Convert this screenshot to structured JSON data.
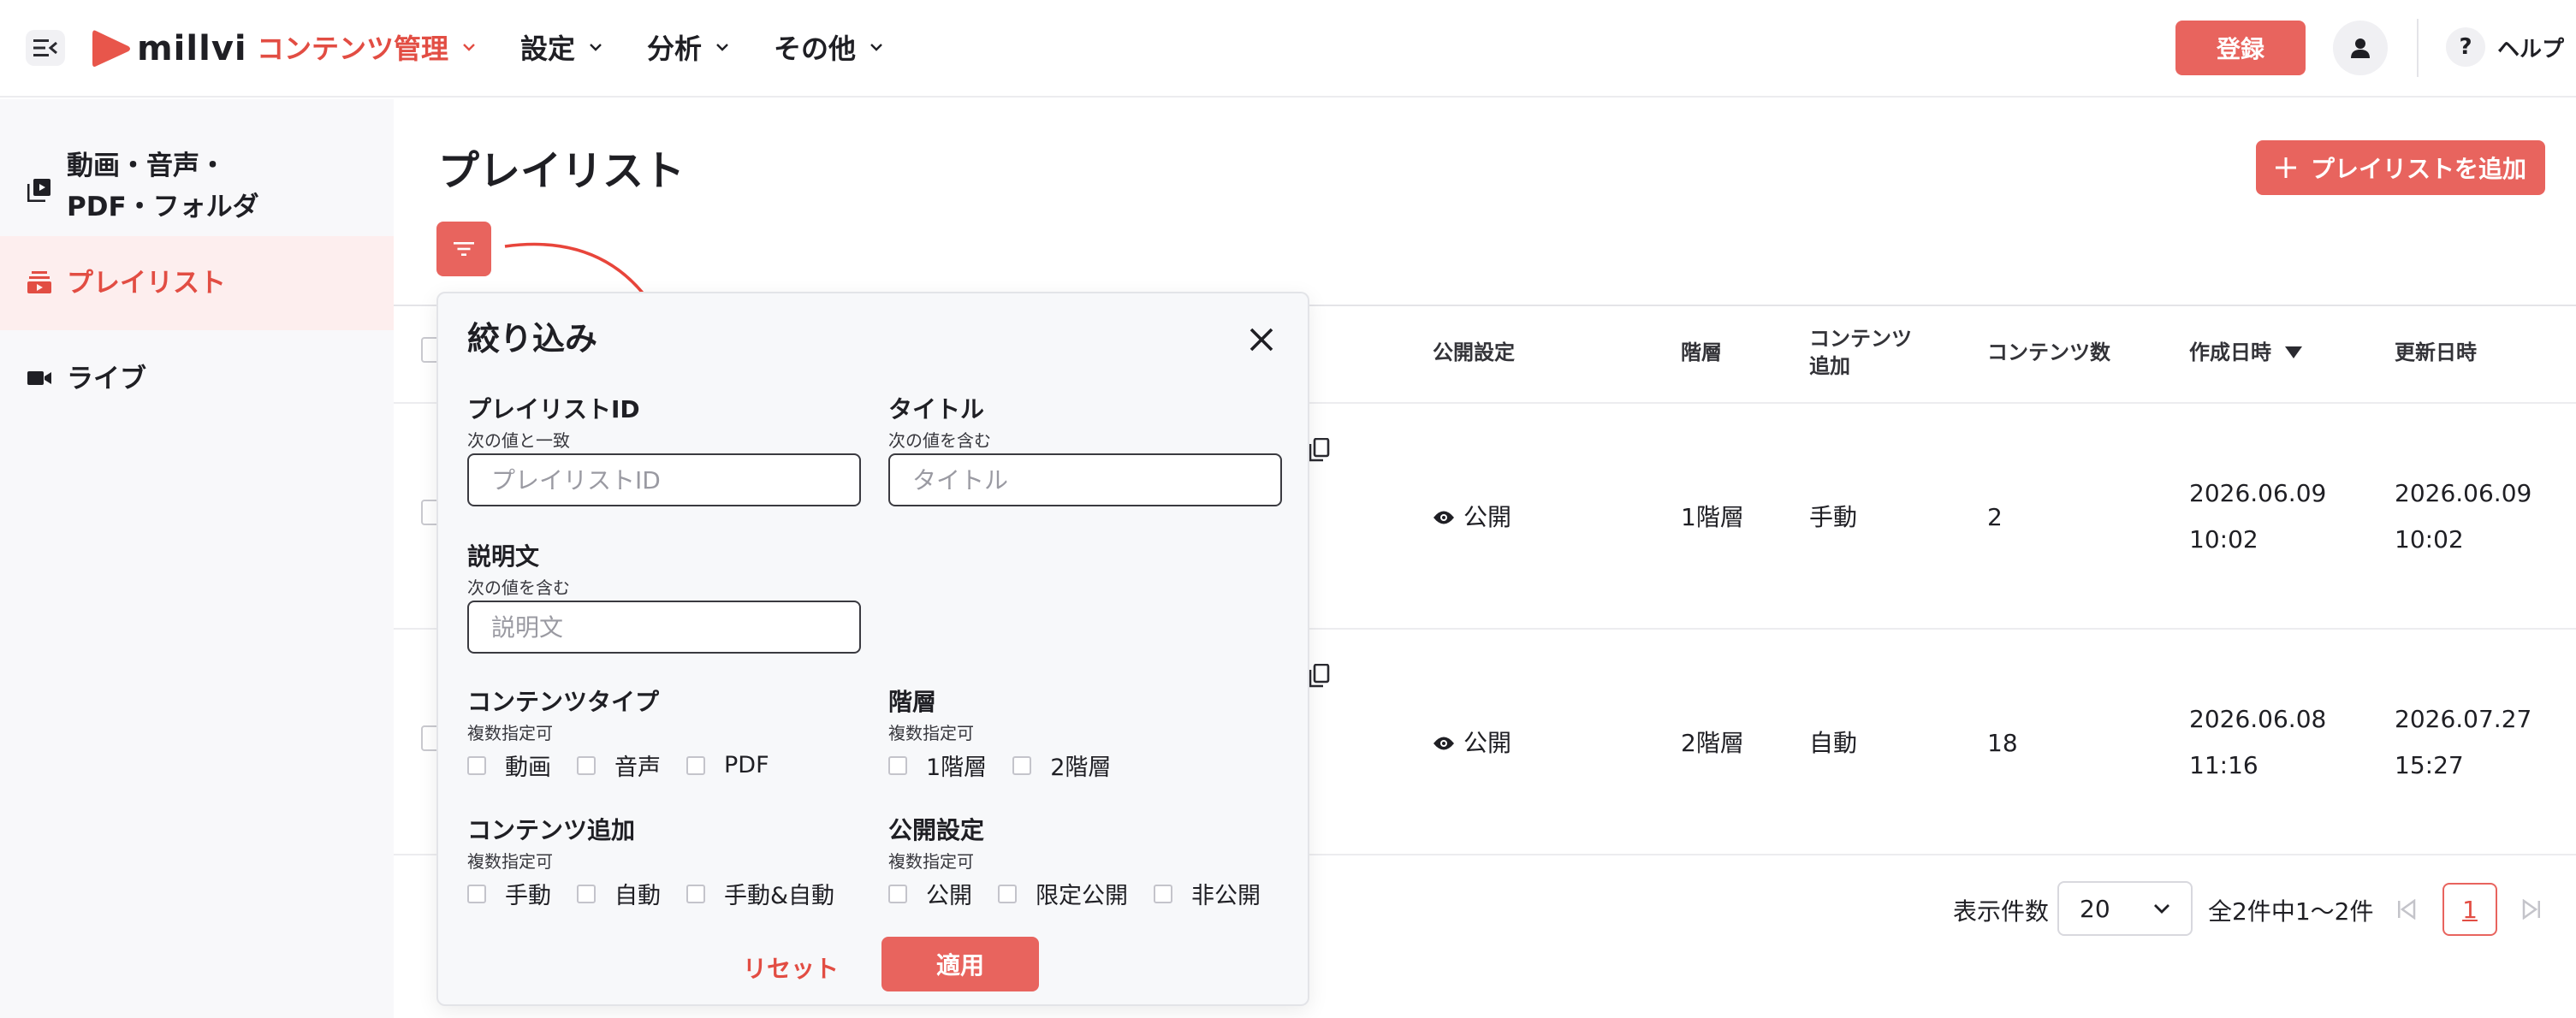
{
  "header": {
    "logo_text": "millvi",
    "nav": [
      {
        "label": "コンテンツ管理",
        "active": true
      },
      {
        "label": "設定",
        "active": false
      },
      {
        "label": "分析",
        "active": false
      },
      {
        "label": "その他",
        "active": false
      }
    ],
    "register_label": "登録",
    "help_symbol": "?",
    "help_label": "ヘルプ"
  },
  "sidebar": {
    "items": [
      {
        "label": "動画・音声・\nPDF・フォルダ",
        "line1": "動画・音声・",
        "line2": "PDF・フォルダ",
        "icon": "media-library-icon"
      },
      {
        "label": "プレイリスト",
        "icon": "playlist-icon",
        "active": true
      },
      {
        "label": "ライブ",
        "icon": "live-camera-icon"
      }
    ]
  },
  "main": {
    "title": "プレイリスト",
    "add_button_label": "プレイリストを追加",
    "add_button_icon": "plus-icon",
    "filter_button_icon": "filter-icon"
  },
  "table": {
    "columns": {
      "publish": "公開設定",
      "hierarchy": "階層",
      "content_add_1": "コンテンツ",
      "content_add_2": "追加",
      "content_count": "コンテンツ数",
      "created": "作成日時",
      "updated": "更新日時"
    },
    "rows": [
      {
        "publish": "公開",
        "hierarchy": "1階層",
        "content_add": "手動",
        "content_count": "2",
        "created_date": "2026.06.09",
        "created_time": "10:02",
        "updated_date": "2026.06.09",
        "updated_time": "10:02"
      },
      {
        "publish": "公開",
        "hierarchy": "2階層",
        "content_add": "自動",
        "content_count": "18",
        "created_date": "2026.06.08",
        "created_time": "11:16",
        "updated_date": "2026.07.27",
        "updated_time": "15:27"
      }
    ]
  },
  "pagination": {
    "per_page_label": "表示件数",
    "per_page_value": "20",
    "summary": "全2件中1〜2件",
    "current_page": "1"
  },
  "filter": {
    "title": "絞り込み",
    "playlist_id": {
      "label": "プレイリストID",
      "sub": "次の値と一致",
      "placeholder": "プレイリストID",
      "value": ""
    },
    "title_field": {
      "label": "タイトル",
      "sub": "次の値を含む",
      "placeholder": "タイトル",
      "value": ""
    },
    "description": {
      "label": "説明文",
      "sub": "次の値を含む",
      "placeholder": "説明文",
      "value": ""
    },
    "content_type": {
      "label": "コンテンツタイプ",
      "sub": "複数指定可",
      "options": [
        "動画",
        "音声",
        "PDF"
      ]
    },
    "hierarchy": {
      "label": "階層",
      "sub": "複数指定可",
      "options": [
        "1階層",
        "2階層"
      ]
    },
    "content_add": {
      "label": "コンテンツ追加",
      "sub": "複数指定可",
      "options": [
        "手動",
        "自動",
        "手動&自動"
      ]
    },
    "publish": {
      "label": "公開設定",
      "sub": "複数指定可",
      "options": [
        "公開",
        "限定公開",
        "非公開"
      ]
    },
    "reset_label": "リセット",
    "apply_label": "適用"
  },
  "colors": {
    "accent": "#e8645e",
    "accent_text": "#e24d43",
    "sidebar_bg": "#f8f8fa",
    "active_bg": "#fdeeee"
  }
}
